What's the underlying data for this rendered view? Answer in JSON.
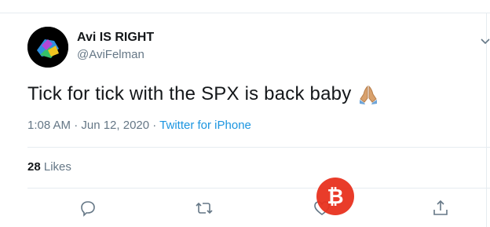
{
  "tweet": {
    "author_name": "Avi IS RIGHT",
    "handle": "@AviFelman",
    "text": "Tick for tick with the SPX is back baby",
    "emoji": "folded-hands-emoji",
    "timestamp": "1:08 AM · Jun 12, 2020 · ",
    "source": "Twitter for iPhone",
    "likes_count": "28",
    "likes_label": "Likes"
  },
  "actions": {
    "reply": "reply-icon",
    "retweet": "retweet-icon",
    "like": "heart-icon",
    "share": "share-icon"
  },
  "watermark": {
    "symbol": "₿"
  },
  "colors": {
    "text": "#14171a",
    "secondary": "#657786",
    "link": "#1b95e0",
    "divider": "#e6ecf0",
    "watermark": "#e8321f"
  }
}
